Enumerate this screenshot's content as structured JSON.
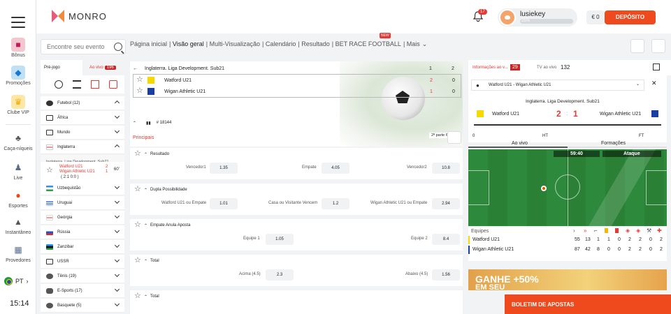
{
  "rail": {
    "items": [
      {
        "label": "Bônus",
        "icon": "gift-icon"
      },
      {
        "label": "Promoções",
        "icon": "promo-icon"
      },
      {
        "label": "Clube VIP",
        "icon": "crown-icon"
      },
      {
        "label": "Caça-níqueis",
        "icon": "slot-icon"
      },
      {
        "label": "Live",
        "icon": "live-icon"
      },
      {
        "label": "Esportes",
        "icon": "ball-icon"
      },
      {
        "label": "Instantâneo",
        "icon": "chart-icon"
      },
      {
        "label": "Provedores",
        "icon": "grid-icon"
      }
    ],
    "lang": "PT",
    "clock": "15:14"
  },
  "header": {
    "brand": "MONRO",
    "bell_count": "17",
    "username": "lusiekey",
    "level_progress": 25,
    "level_label": "25%",
    "balance": "€ 0",
    "deposit_label": "DEPÓSITO"
  },
  "sidebar": {
    "search_placeholder": "Encontre seu evento",
    "tab_pre": "Pré-jogo",
    "tab_live": "Ao vivo",
    "live_count": "196",
    "rows": [
      {
        "label": "Futebol (12)",
        "chev": "up"
      },
      {
        "label": "África",
        "chev": "down"
      },
      {
        "label": "Mundo",
        "chev": "down"
      },
      {
        "label": "Inglaterra",
        "chev": "up"
      }
    ],
    "league": "Inglaterra. Liga Development. Sub21",
    "match_team1": "Watford U21",
    "match_team2": "Wigan Athletic U21",
    "match_s1": "2",
    "match_s2": "1",
    "match_sub": "( 2:1  0:0 )",
    "match_min": "60'",
    "rows2": [
      {
        "label": "Uzbequistão",
        "chev": "down"
      },
      {
        "label": "Uruguai",
        "chev": "down"
      },
      {
        "label": "Geórgia",
        "chev": "down"
      },
      {
        "label": "Rússia",
        "chev": "down"
      },
      {
        "label": "Zanzibar",
        "chev": "down"
      },
      {
        "label": "USSR",
        "chev": "down"
      },
      {
        "label": "Tênis (19)",
        "chev": "down"
      },
      {
        "label": "E-Sports (17)",
        "chev": "down"
      },
      {
        "label": "Basquete (5)",
        "chev": "down"
      }
    ]
  },
  "nav": {
    "items": [
      "Página inicial",
      "Visão geral",
      "Multi-Visualização",
      "Calendário",
      "Resultado",
      "BET RACE FOOTBALL",
      "Mais"
    ],
    "new_badge": "NEW"
  },
  "event": {
    "league": "Inglaterra. Liga Development. Sub21",
    "team1": "Watford U21",
    "team2": "Wigan Athletic U21",
    "col1": "1",
    "col2": "2",
    "t1_s1": "2",
    "t1_s2": "0",
    "t2_s1": "1",
    "t2_s2": "0",
    "id": "# 18144",
    "period": "2ª parte",
    "minute": "60'",
    "tab_main": "Principais"
  },
  "markets": [
    {
      "title": "Resultado",
      "odds": [
        {
          "label": "Vencedor1",
          "value": "1.35"
        },
        {
          "label": "Empate",
          "value": "4.05"
        },
        {
          "label": "Vencedor2",
          "value": "10.8"
        }
      ]
    },
    {
      "title": "Dupla Possibilidade",
      "odds": [
        {
          "label": "Watford U21 ou Empate",
          "value": "1.01"
        },
        {
          "label": "Casa ou Visitante Vencem",
          "value": "1.2"
        },
        {
          "label": "Wigan Athletic U21 ou Empate",
          "value": "2.94"
        }
      ]
    },
    {
      "title": "Empate Anula Aposta",
      "odds": [
        {
          "label": "Equipe 1",
          "value": "1.05"
        },
        {
          "label": "Equipe 2",
          "value": "8.4"
        }
      ]
    },
    {
      "title": "Total",
      "odds": [
        {
          "label": "Acima (4.5)",
          "value": "2.3"
        },
        {
          "label": "Abaixo (4.5)",
          "value": "1.56"
        }
      ]
    },
    {
      "title": "Total",
      "odds": []
    }
  ],
  "right": {
    "tab_info": "Informações ao v...",
    "info_count": "29",
    "tab_tv": "TV ao vivo",
    "tv_count": "132",
    "match_select": "Watford U21 - Wigan Athletic U21",
    "league": "Inglaterra. Liga Development. Sub21",
    "team1": "Watford U21",
    "team2": "Wigan Athletic U21",
    "score1": "2",
    "score2": "1",
    "timeline": [
      "0",
      "HT",
      "FT"
    ],
    "tab_live": "Ao vivo",
    "tab_form": "Formações",
    "clock": "59:40",
    "attack": "Ataque",
    "stats_header": "Equipes",
    "stats": [
      {
        "team": "Watford U21",
        "vals": [
          "55",
          "13",
          "1",
          "1",
          "0",
          "2",
          "2",
          "0",
          "2"
        ]
      },
      {
        "team": "Wigan Athletic U21",
        "vals": [
          "87",
          "42",
          "8",
          "0",
          "0",
          "2",
          "2",
          "0",
          "2"
        ]
      }
    ],
    "promo": "GANHE +50%",
    "promo2": "EM SEU"
  },
  "betslip": "BOLETIM DE APOSTAS",
  "colors": {
    "accent": "#ee4a1e",
    "live": "#e53935",
    "pitch": "#2d8a3c"
  }
}
